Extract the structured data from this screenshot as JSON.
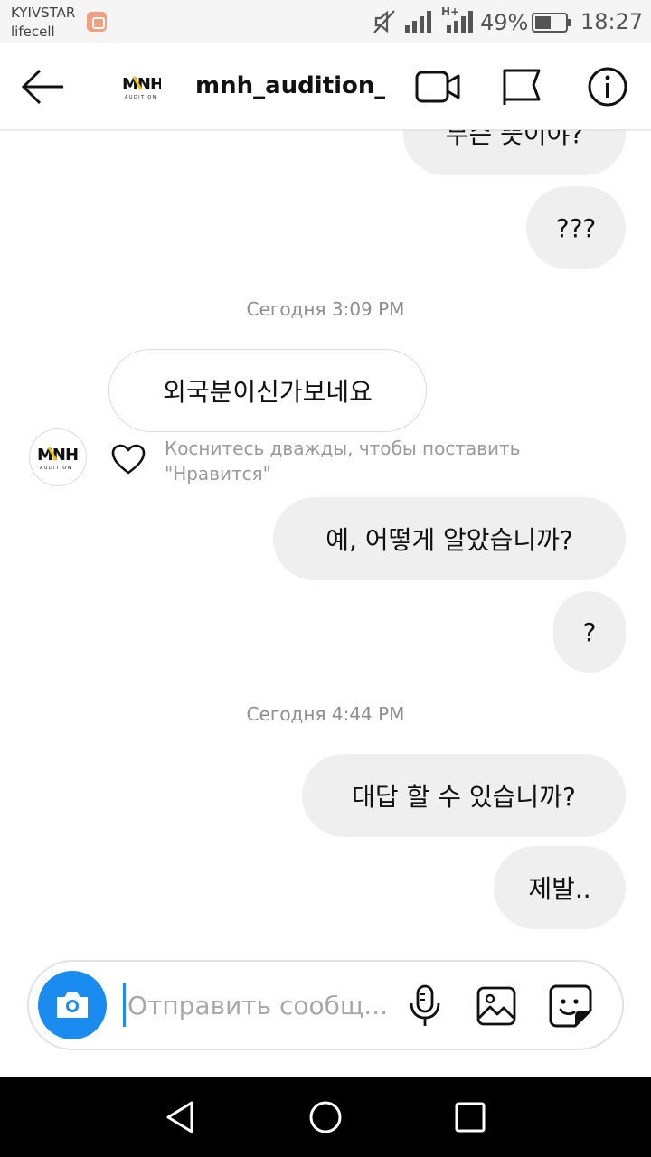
{
  "status_bar": {
    "carrier_1": "KYIVSTAR",
    "carrier_2": "lifecell",
    "network": "H+",
    "battery": "49%",
    "time": "18:27"
  },
  "header": {
    "title": "mnh_audition_...",
    "avatar_logo": "MNH",
    "avatar_sub": "AUDITION"
  },
  "chat": {
    "partial_top": "무슨 뜻이야?",
    "msg_1": "???",
    "time_1": "Сегодня 3:09 PM",
    "incoming_1": "외국분이신가보네요",
    "like_hint_1": "Коснитесь дважды, чтобы поставить",
    "like_hint_2": "\"Нравится\"",
    "msg_2": "예, 어떻게 알았습니까?",
    "msg_3": "?",
    "time_2": "Сегодня 4:44 PM",
    "msg_4": "대답 할 수 있습니까?",
    "msg_5": "제발.."
  },
  "composer": {
    "placeholder": "Отправить сообщ..."
  },
  "icons": {
    "accent": "#1a8cf0",
    "bubble_out_bg": "#efefef"
  }
}
